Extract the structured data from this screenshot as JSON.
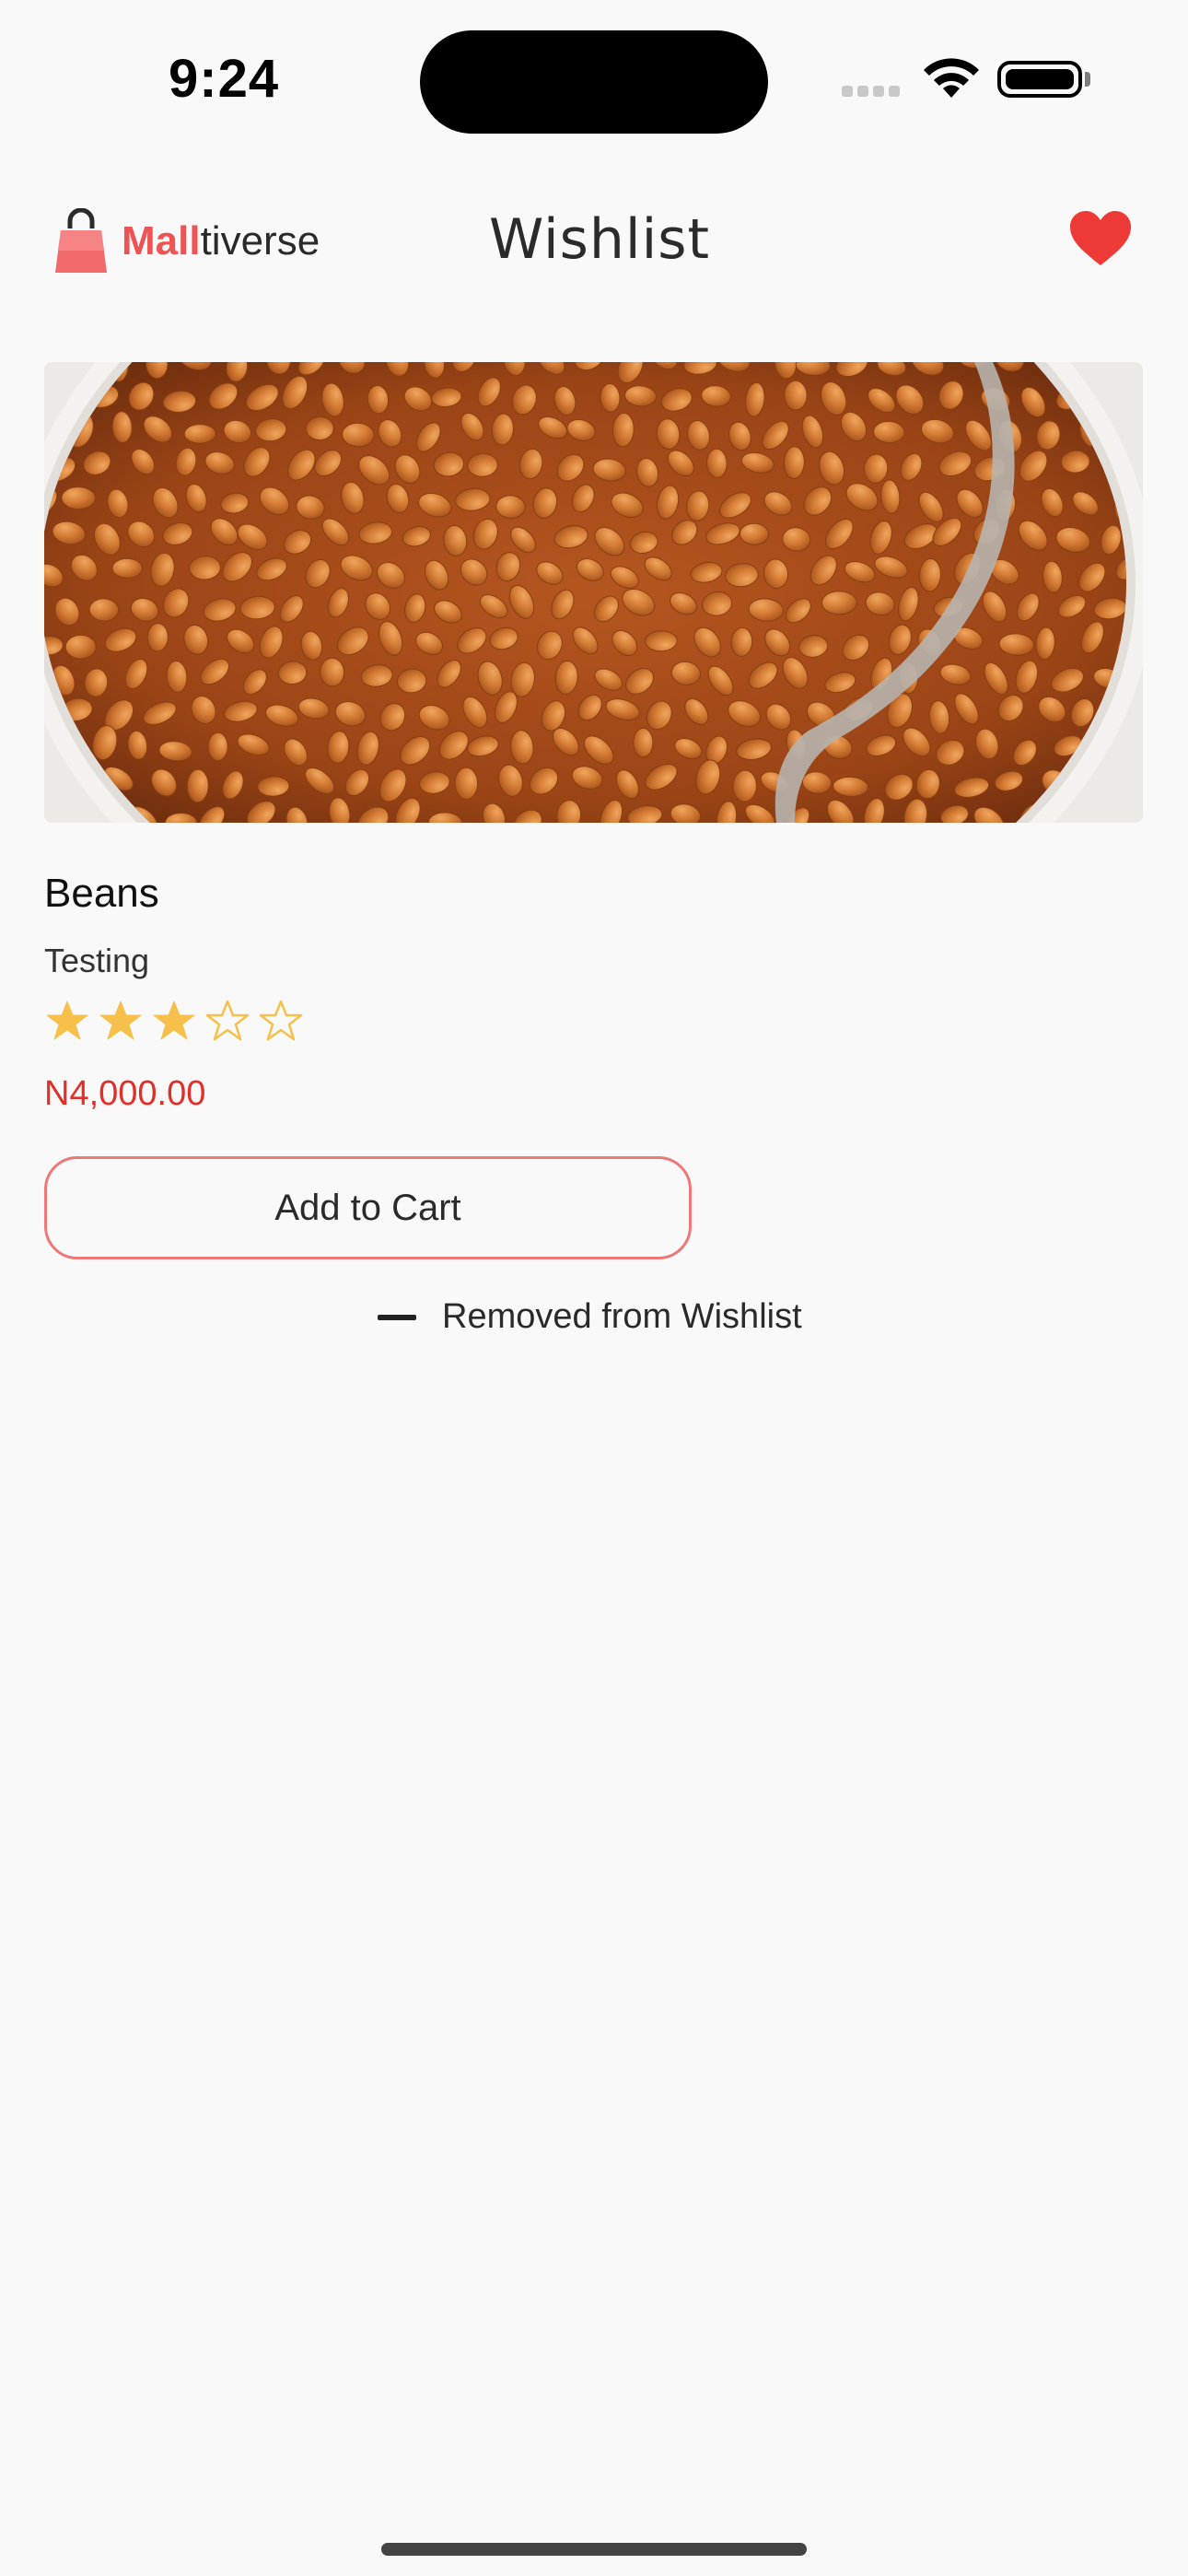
{
  "status_bar": {
    "time": "9:24"
  },
  "header": {
    "logo": {
      "brand_highlight": "Mall",
      "brand_rest": "tiverse"
    },
    "title": "Wishlist",
    "heart_icon": "heart-icon"
  },
  "product": {
    "image_description": "bowl of baked beans with spoon",
    "name": "Beans",
    "description": "Testing",
    "rating": 3,
    "rating_max": 5,
    "price": "N4,000.00",
    "add_to_cart_label": "Add to Cart",
    "wishlist_toggle_label": "Removed from Wishlist"
  },
  "colors": {
    "accent": "#ef5454",
    "price": "#e0302a",
    "star": "#f7c04a",
    "heart": "#ee3a36"
  }
}
